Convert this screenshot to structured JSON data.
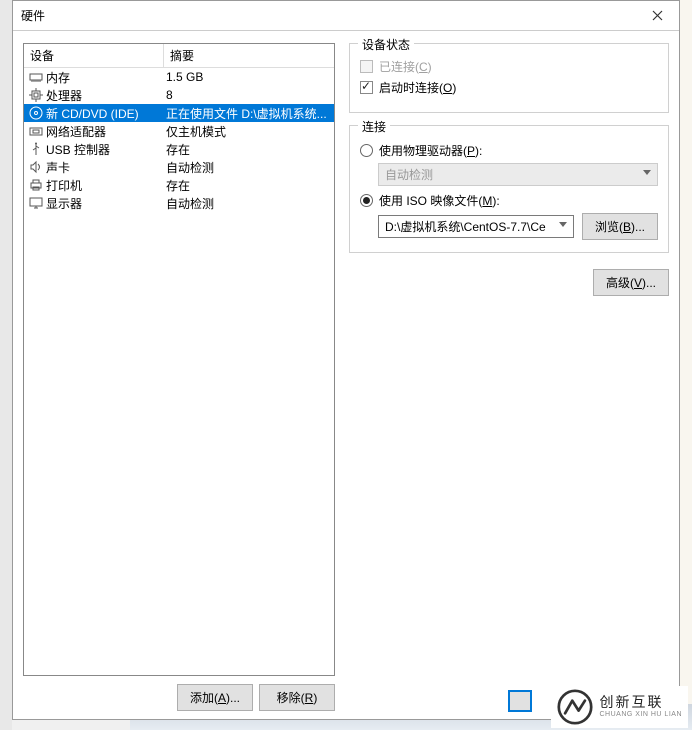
{
  "dialog": {
    "title": "硬件",
    "close_icon_name": "close-icon"
  },
  "table": {
    "headers": {
      "device": "设备",
      "summary": "摘要"
    },
    "rows": [
      {
        "icon": "memory-icon",
        "device": "内存",
        "summary": "1.5 GB",
        "selected": false
      },
      {
        "icon": "cpu-icon",
        "device": "处理器",
        "summary": "8",
        "selected": false
      },
      {
        "icon": "disc-icon",
        "device": "新 CD/DVD (IDE)",
        "summary": "正在使用文件 D:\\虚拟机系统...",
        "selected": true
      },
      {
        "icon": "nic-icon",
        "device": "网络适配器",
        "summary": "仅主机模式",
        "selected": false
      },
      {
        "icon": "usb-icon",
        "device": "USB 控制器",
        "summary": "存在",
        "selected": false
      },
      {
        "icon": "sound-icon",
        "device": "声卡",
        "summary": "自动检测",
        "selected": false
      },
      {
        "icon": "printer-icon",
        "device": "打印机",
        "summary": "存在",
        "selected": false
      },
      {
        "icon": "display-icon",
        "device": "显示器",
        "summary": "自动检测",
        "selected": false
      }
    ]
  },
  "buttons": {
    "add": {
      "pre": "添加(",
      "key": "A",
      "post": ")..."
    },
    "remove": {
      "pre": "移除(",
      "key": "R",
      "post": ")"
    },
    "browse": {
      "pre": "浏览(",
      "key": "B",
      "post": ")..."
    },
    "advanced": {
      "pre": "高级(",
      "key": "V",
      "post": ")..."
    }
  },
  "device_status": {
    "title": "设备状态",
    "connected": {
      "pre": "已连接(",
      "key": "C",
      "post": ")",
      "checked": false,
      "disabled": true
    },
    "connect_on_start": {
      "pre": "启动时连接(",
      "key": "O",
      "post": ")",
      "checked": true,
      "disabled": false
    }
  },
  "connection": {
    "title": "连接",
    "physical": {
      "pre": "使用物理驱动器(",
      "key": "P",
      "post": "):",
      "checked": false
    },
    "physical_dropdown": "自动检测",
    "iso": {
      "pre": "使用 ISO 映像文件(",
      "key": "M",
      "post": "):",
      "checked": true
    },
    "iso_path": "D:\\虚拟机系统\\CentOS-7.7\\Ce"
  },
  "logo": {
    "cn": "创新互联",
    "en": "CHUANG XIN HU LIAN"
  }
}
